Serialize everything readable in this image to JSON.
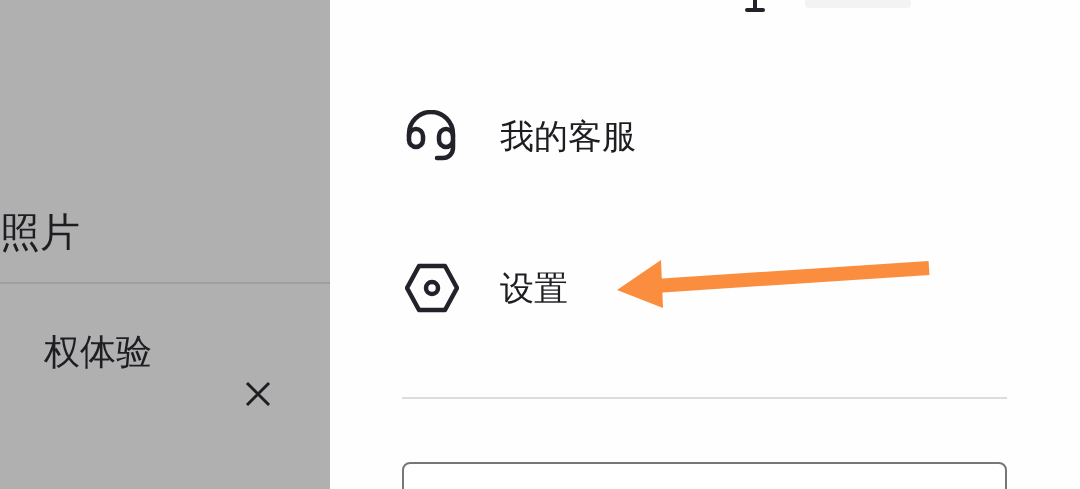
{
  "background_panel": {
    "items": [
      {
        "label": "照片"
      },
      {
        "label": "权体验"
      }
    ]
  },
  "menu": {
    "items": [
      {
        "kind": "headset",
        "label": "我的客服"
      },
      {
        "kind": "settings",
        "label": "设置"
      }
    ]
  }
}
